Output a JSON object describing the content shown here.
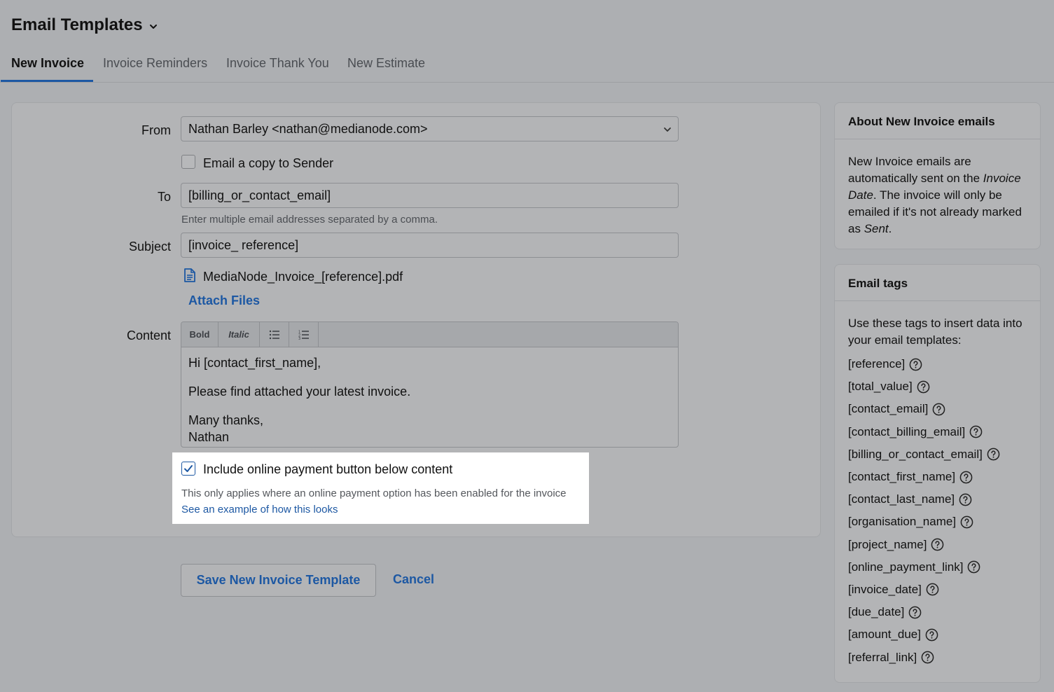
{
  "header": {
    "title": "Email Templates"
  },
  "tabs": [
    {
      "label": "New Invoice",
      "active": true
    },
    {
      "label": "Invoice Reminders",
      "active": false
    },
    {
      "label": "Invoice Thank You",
      "active": false
    },
    {
      "label": "New Estimate",
      "active": false
    }
  ],
  "form": {
    "from_label": "From",
    "from_value": "Nathan Barley <nathan@medianode.com>",
    "copy_sender_label": "Email a copy to Sender",
    "copy_sender_checked": false,
    "to_label": "To",
    "to_value": "[billing_or_contact_email]",
    "to_hint": "Enter multiple email addresses separated by a comma.",
    "subject_label": "Subject",
    "subject_value": "[invoice_ reference]",
    "attachment_name": "MediaNode_Invoice_[reference].pdf",
    "attach_files_label": "Attach Files",
    "content_label": "Content",
    "toolbar": {
      "bold": "Bold",
      "italic": "Italic",
      "bullet_icon": "bullet-list-icon",
      "numbered_icon": "numbered-list-icon"
    },
    "content_lines": {
      "greeting": "Hi [contact_first_name],",
      "body": "Please find attached your latest invoice.",
      "signoff": "Many thanks,",
      "name": "Nathan"
    },
    "payment_button_label": "Include online payment button below content",
    "payment_button_checked": true,
    "payment_hint": "This only applies where an online payment option has been enabled for the invoice",
    "example_link": "See an example of how this looks"
  },
  "actions": {
    "save_label": "Save New Invoice Template",
    "cancel_label": "Cancel"
  },
  "about": {
    "heading": "About New Invoice emails",
    "text_1": "New Invoice emails are automatically sent on the ",
    "text_em_1": "Invoice Date",
    "text_2": ". The invoice will only be emailed if it's not already marked as ",
    "text_em_2": "Sent",
    "text_3": "."
  },
  "tags": {
    "heading": "Email tags",
    "intro": "Use these tags to insert data into your email templates:",
    "items": [
      "[reference]",
      "[total_value]",
      "[contact_email]",
      "[contact_billing_email]",
      "[billing_or_contact_email]",
      "[contact_first_name]",
      "[contact_last_name]",
      "[organisation_name]",
      "[project_name]",
      "[online_payment_link]",
      "[invoice_date]",
      "[due_date]",
      "[amount_due]",
      "[referral_link]"
    ]
  },
  "colors": {
    "accent": "#1d58a3",
    "overlay_background": "#adafb2",
    "highlight_background": "#ffffff"
  }
}
